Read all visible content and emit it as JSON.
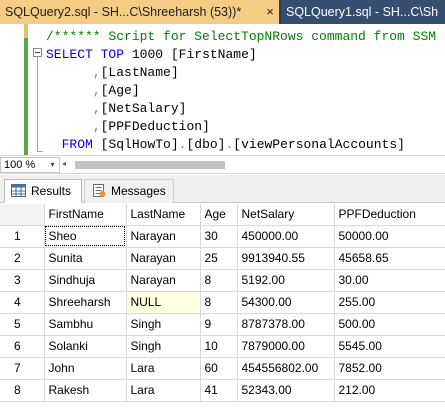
{
  "editor_tabs": [
    {
      "label": "SQLQuery2.sql - SH...C\\Shreeharsh (53))*",
      "active": true,
      "close_glyph": "×"
    },
    {
      "label": "SQLQuery1.sql - SH...C\\Sh",
      "active": false
    }
  ],
  "code": {
    "comment": "/****** Script for SelectTopNRows command from SSM",
    "select_kw": "SELECT",
    "top_kw": "TOP",
    "top_num": "1000",
    "first_col": "[FirstName]",
    "col_lastname": "[LastName]",
    "col_age": "[Age]",
    "col_netsalary": "[NetSalary]",
    "col_ppf": "[PPFDeduction]",
    "from_kw": "FROM",
    "db": "[SqlHowTo]",
    "schema": "[dbo]",
    "view": "[viewPersonalAccounts]",
    "comma": ",",
    "dot": "."
  },
  "zoom": {
    "value": "100 %",
    "arrow": "▾",
    "scroll_left": "◂"
  },
  "results_tabs": [
    {
      "label": "Results",
      "active": true,
      "icon": "grid-icon"
    },
    {
      "label": "Messages",
      "active": false,
      "icon": "messages-icon"
    }
  ],
  "grid": {
    "columns": [
      "FirstName",
      "LastName",
      "Age",
      "NetSalary",
      "PPFDeduction"
    ],
    "rows": [
      {
        "num": "1",
        "cells": [
          "Sheo",
          "Narayan",
          "30",
          "450000.00",
          "50000.00"
        ]
      },
      {
        "num": "2",
        "cells": [
          "Sunita",
          "Narayan",
          "25",
          "9913940.55",
          "45658.65"
        ]
      },
      {
        "num": "3",
        "cells": [
          "Sindhuja",
          "Narayan",
          "8",
          "5192.00",
          "30.00"
        ]
      },
      {
        "num": "4",
        "cells": [
          "Shreeharsh",
          "NULL",
          "8",
          "54300.00",
          "255.00"
        ]
      },
      {
        "num": "5",
        "cells": [
          "Sambhu",
          "Singh",
          "9",
          "8787378.00",
          "500.00"
        ]
      },
      {
        "num": "6",
        "cells": [
          "Solanki",
          "Singh",
          "10",
          "7879000.00",
          "5545.00"
        ]
      },
      {
        "num": "7",
        "cells": [
          "John",
          "Lara",
          "60",
          "454556802.00",
          "7852.00"
        ]
      },
      {
        "num": "8",
        "cells": [
          "Rakesh",
          "Lara",
          "41",
          "52343.00",
          "212.00"
        ]
      }
    ]
  },
  "colors": {
    "tab_active": "#f5cc84",
    "tab_inactive": "#364e6f",
    "tab_strip": "#2b3c5c",
    "keyword": "#0000ff",
    "comment": "#008000",
    "punctuation": "#808080",
    "null_cell": "#ffffe1"
  }
}
